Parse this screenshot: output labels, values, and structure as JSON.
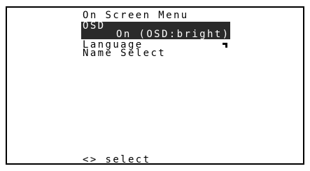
{
  "menu": {
    "title": "On Screen Menu",
    "items": [
      {
        "label": "OSD",
        "value": "On (OSD:bright)",
        "selected": true
      },
      {
        "label": "Language"
      },
      {
        "label": "Name Select"
      }
    ],
    "footer_hint": "<> select"
  },
  "colors": {
    "background": "#ffffff",
    "frame": "#000000",
    "text": "#000000",
    "highlight_bar": "#2b2b2b",
    "highlight_text": "#ffffff"
  },
  "icons": {
    "language_marker": "corner-bracket-icon"
  }
}
